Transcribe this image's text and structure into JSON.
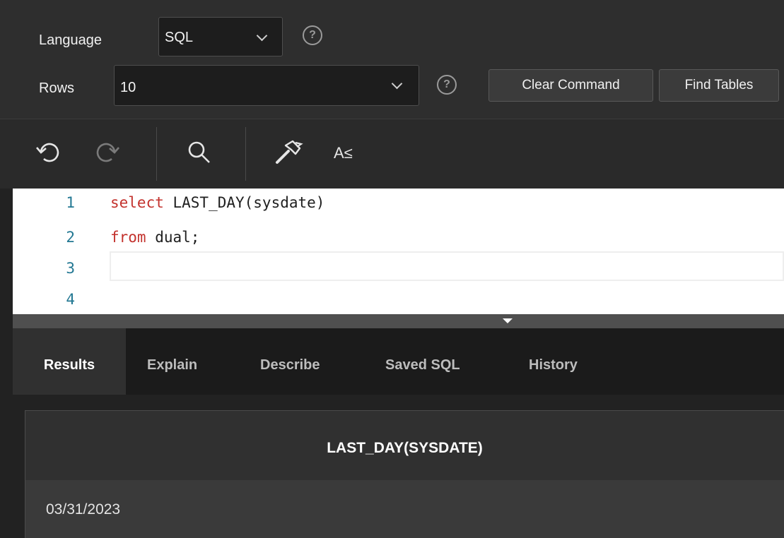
{
  "toolbar": {
    "language_label": "Language",
    "language_value": "SQL",
    "rows_label": "Rows",
    "rows_value": "10",
    "help_glyph": "?",
    "clear_command_label": "Clear Command",
    "find_tables_label": "Find Tables"
  },
  "editor_toolbar": {
    "icons": [
      "undo-icon",
      "redo-icon",
      "search-icon",
      "hammer-icon",
      "autocomplete-icon"
    ],
    "autocomplete_glyph": "A≤"
  },
  "editor": {
    "line_numbers": [
      "1",
      "2",
      "3",
      "4"
    ],
    "lines": [
      {
        "keyword": "select",
        "rest": " LAST_DAY(sysdate)"
      },
      {
        "keyword": "from",
        "rest": " dual;"
      }
    ],
    "keyword_color": "#c3322d"
  },
  "tabs": [
    "Results",
    "Explain",
    "Describe",
    "Saved SQL",
    "History"
  ],
  "active_tab": "Results",
  "results": {
    "columns": [
      "LAST_DAY(SYSDATE)"
    ],
    "rows": [
      [
        "03/31/2023"
      ]
    ]
  }
}
